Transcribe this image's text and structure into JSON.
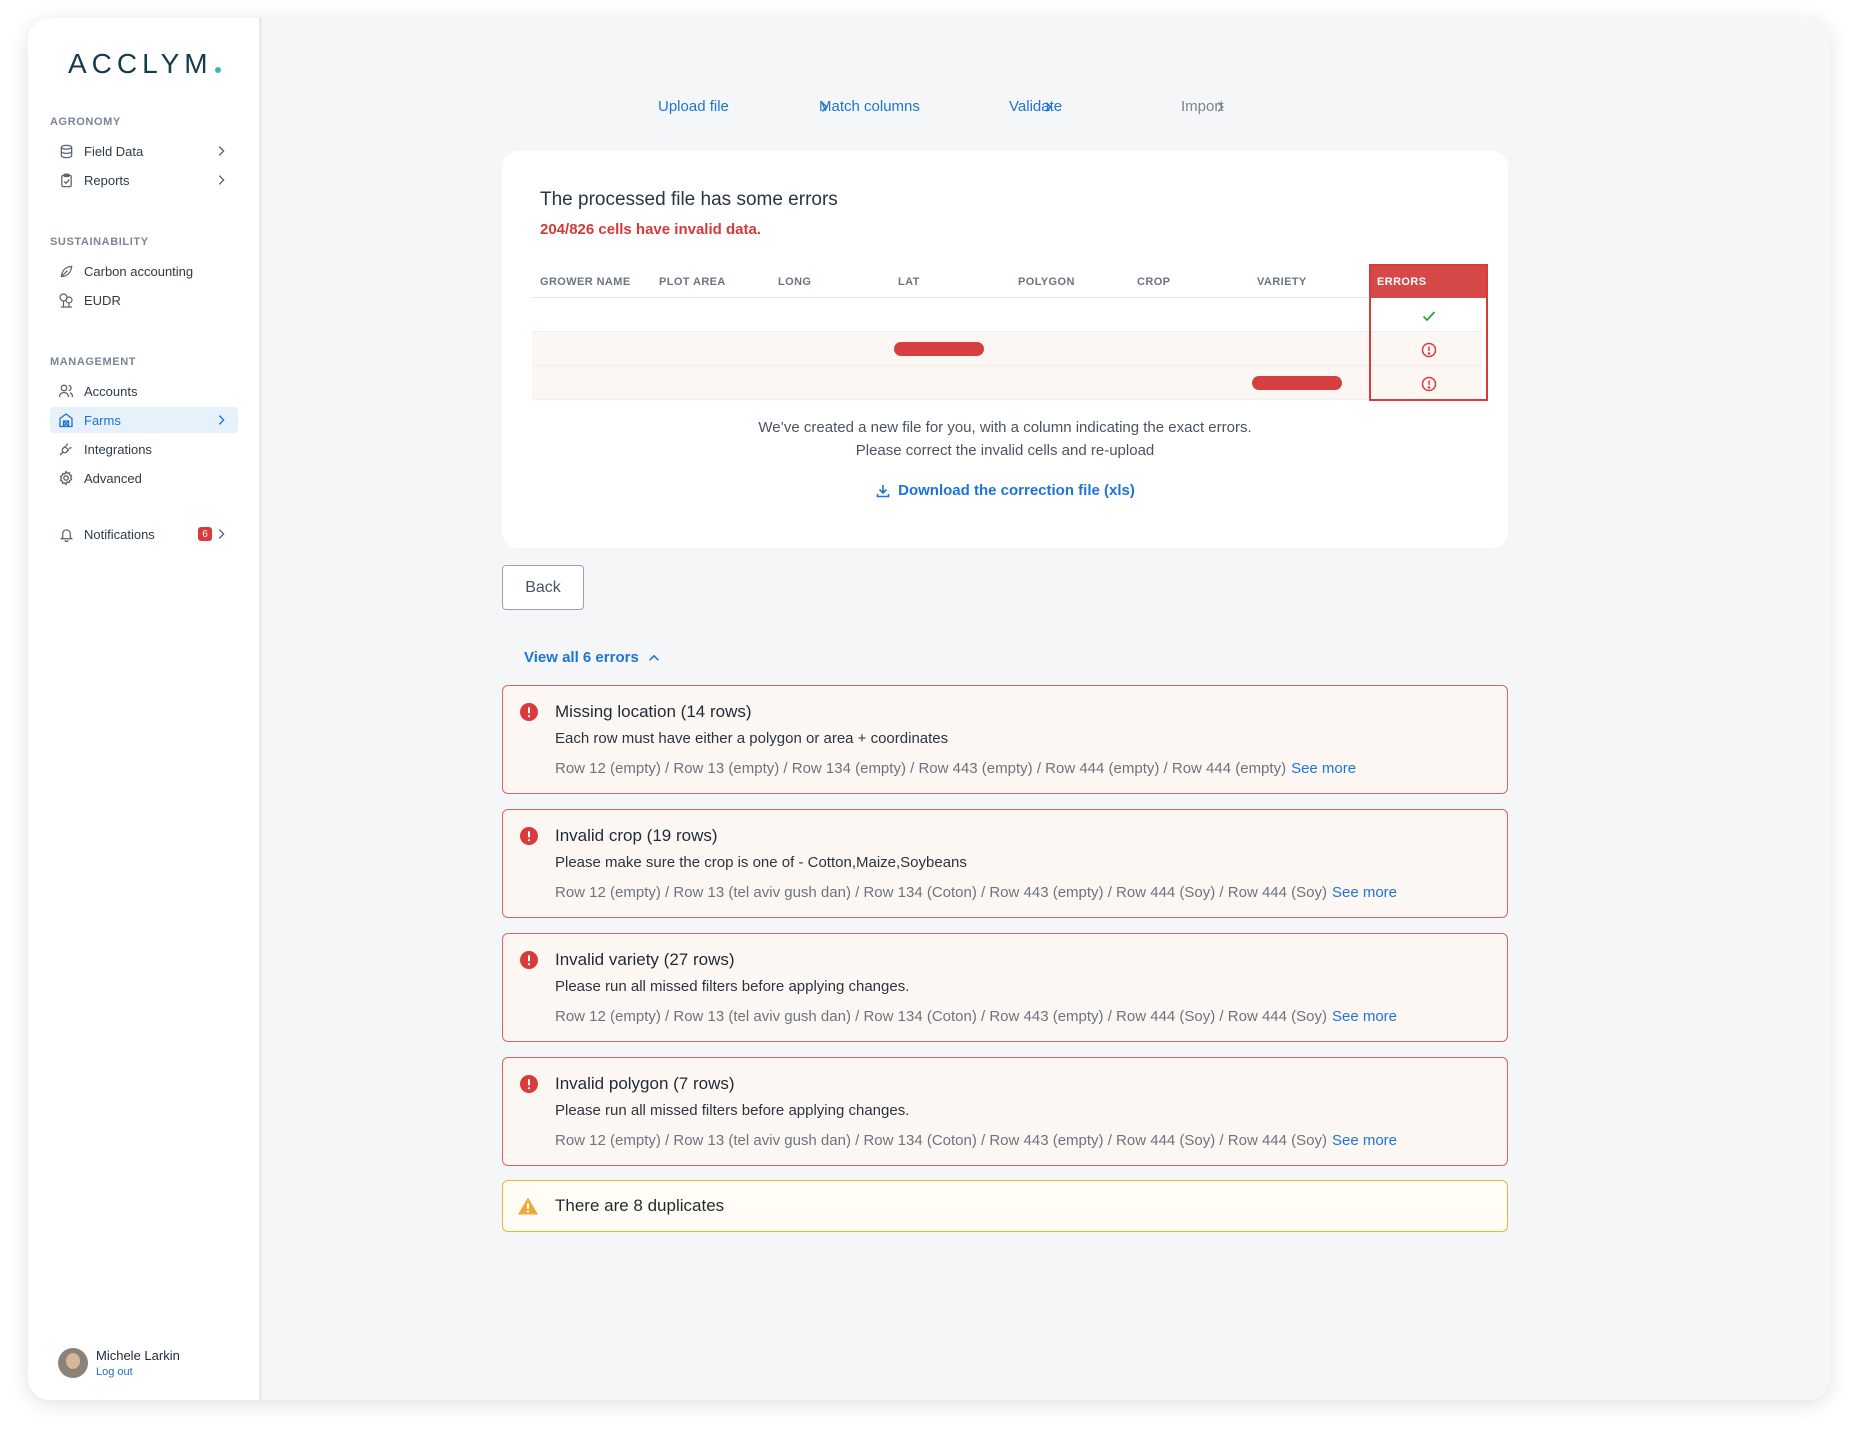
{
  "app": {
    "logo_text": "ACCLYM",
    "brand_color": "#163b4a",
    "accent_color": "#1d74d8",
    "error_color": "#d93a3a",
    "warning_color": "#f0b43c"
  },
  "sidebar": {
    "sections": [
      {
        "label": "AGRONOMY"
      },
      {
        "label": "SUSTAINABILITY"
      },
      {
        "label": "MANAGEMENT"
      }
    ],
    "items": [
      {
        "label": "Field Data",
        "icon": "database-icon",
        "has_chevron": true
      },
      {
        "label": "Reports",
        "icon": "clipboard-icon",
        "has_chevron": true
      },
      {
        "label": "Carbon accounting",
        "icon": "leaf-icon",
        "has_chevron": false
      },
      {
        "label": "EUDR",
        "icon": "trees-icon",
        "has_chevron": false
      },
      {
        "label": "Accounts",
        "icon": "users-icon",
        "has_chevron": false
      },
      {
        "label": "Farms",
        "icon": "farm-icon",
        "has_chevron": true,
        "active": true
      },
      {
        "label": "Integrations",
        "icon": "plug-icon",
        "has_chevron": false
      },
      {
        "label": "Advanced",
        "icon": "gear-icon",
        "has_chevron": false
      },
      {
        "label": "Notifications",
        "icon": "bell-icon",
        "has_chevron": true,
        "badge": "6"
      }
    ],
    "user": {
      "name": "Michele Larkin",
      "logout": "Log out"
    }
  },
  "stepper": {
    "steps": [
      {
        "label": "Upload file",
        "state": "done"
      },
      {
        "label": "Match columns",
        "state": "done"
      },
      {
        "label": "Validate",
        "state": "current"
      },
      {
        "label": "Import",
        "state": "pending"
      }
    ]
  },
  "summary": {
    "title": "The processed file has some errors",
    "subtitle": "204/826 cells have invalid data.",
    "columns": [
      "GROWER NAME",
      "PLOT AREA",
      "LONG",
      "LAT",
      "POLYGON",
      "CROP",
      "VARIETY",
      "ERRORS"
    ],
    "rows": [
      {
        "status": "ok",
        "error_cell": ""
      },
      {
        "status": "error",
        "error_cell": "LAT"
      },
      {
        "status": "error",
        "error_cell": "VARIETY"
      }
    ],
    "message_line1": "We’ve created a new file for you, with a column indicating the exact errors.",
    "message_line2": "Please correct the invalid cells and re-upload",
    "download_label": "Download the correction file (xls)"
  },
  "actions": {
    "back_label": "Back",
    "view_all_label": "View all 6 errors"
  },
  "errors": [
    {
      "title": "Missing location (14 rows)",
      "description": "Each row must have either a polygon or area + coordinates",
      "rows": "Row 12 (empty) / Row 13 (empty) / Row 134 (empty) / Row 443 (empty) / Row 444 (empty) / Row 444 (empty)",
      "see_more": "See more"
    },
    {
      "title": "Invalid crop (19 rows)",
      "description": "Please make sure the crop is one of - Cotton,Maize,Soybeans",
      "rows": "Row 12 (empty) / Row 13 (tel aviv gush dan) / Row 134 (Coton) / Row 443 (empty) / Row 444 (Soy) / Row 444 (Soy)",
      "see_more": "See more"
    },
    {
      "title": "Invalid variety (27 rows)",
      "description": "Please run all missed filters before applying changes.",
      "rows": "Row 12 (empty) / Row 13 (tel aviv gush dan) / Row 134 (Coton) / Row 443 (empty) / Row 444 (Soy) / Row 444 (Soy)",
      "see_more": "See more"
    },
    {
      "title": "Invalid polygon (7 rows)",
      "description": "Please run all missed filters before applying changes.",
      "rows": "Row 12 (empty) / Row 13 (tel aviv gush dan) / Row 134 (Coton) / Row 443 (empty) / Row 444 (Soy) / Row 444 (Soy)",
      "see_more": "See more"
    }
  ],
  "warning": {
    "title": "There are 8 duplicates"
  }
}
